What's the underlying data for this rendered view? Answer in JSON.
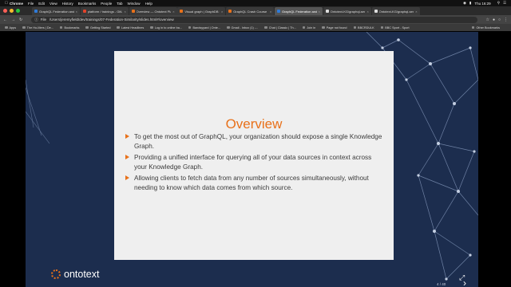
{
  "menubar": {
    "app": "Chrome",
    "items": [
      "File",
      "Edit",
      "View",
      "History",
      "Bookmarks",
      "People",
      "Tab",
      "Window",
      "Help"
    ],
    "clock": "Thu 16:29"
  },
  "tabs": [
    {
      "title": "GraphQL Federation and",
      "favicon": "#2f7bd9"
    },
    {
      "title": "platform / trainings - GitLab",
      "favicon": "#e2432a"
    },
    {
      "title": "Overview — Ontotext Pla",
      "favicon": "#e8711a"
    },
    {
      "title": "Visual graph | GraphDB Fr",
      "favicon": "#e8711a"
    },
    {
      "title": "GraphQL Crash Course",
      "favicon": "#e8711a"
    },
    {
      "title": "GraphQL Federation and",
      "favicon": "#2f7bd9",
      "active": true
    },
    {
      "title": "Ontotext-KG/graphql-sem",
      "favicon": "#dddddd"
    },
    {
      "title": "Ontotext-KG/graphql-sem",
      "favicon": "#dddddd"
    }
  ],
  "address": {
    "scheme": "File",
    "url": "/Users/jeremyfield/dev/trainings/07-Federation-Similarity/slides.html#/overview"
  },
  "bookmarks": {
    "apps": "Apps",
    "items": [
      "The Ho-Mers | De...",
      "Bookmarks",
      "Getting Started",
      "Latest Headlines",
      "Log in to online ba...",
      "Bandsyyard | Onte...",
      "Gmail - Inbox (1) -...",
      "Chat | Classic | Th...",
      "Join in",
      "Page not found",
      "BBCRDULK",
      "BBC Sport - Sport"
    ],
    "other": "Other Bookmarks"
  },
  "slide": {
    "title": "Overview",
    "bullets": [
      "To get the most out of GraphQL, your organization should expose a single Knowledge Graph.",
      "Providing a unified interface for querying all of your data sources in context across your Knowledge Graph.",
      "Allowing clients to fetch data from any number of sources simultaneously, without needing to know which data comes from which source."
    ],
    "logo_text": "ontotext",
    "page_number": "4 / 40"
  },
  "colors": {
    "slide_bg": "#1c2d4e",
    "card_bg": "#efefef",
    "accent": "#e8711a"
  }
}
